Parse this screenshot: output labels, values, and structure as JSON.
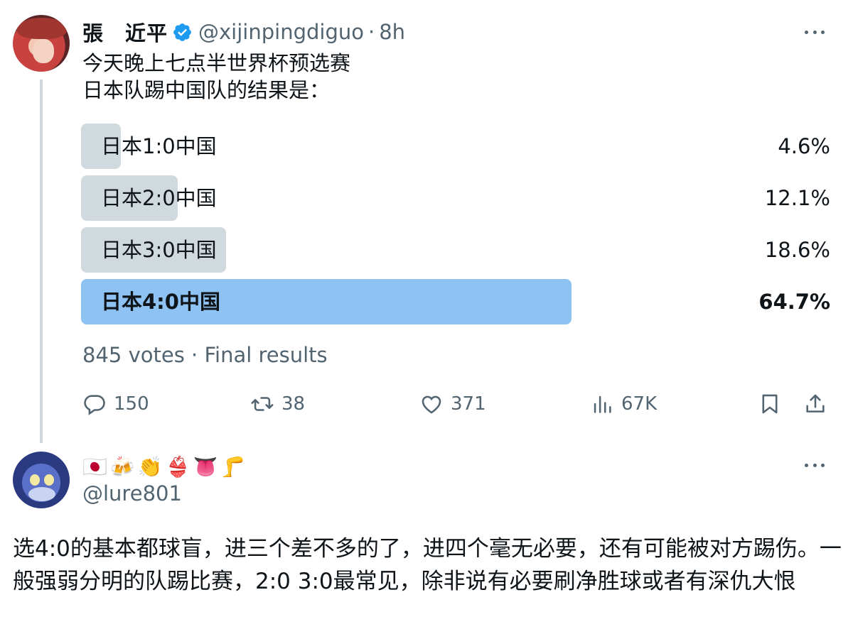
{
  "tweet": {
    "display_name": "張　近平",
    "handle": "@xijinpingdiguo",
    "separator": "·",
    "time": "8h",
    "text_line1": "今天晚上七点半世界杯预选赛",
    "text_line2": "日本队踢中国队的结果是：",
    "poll": {
      "options": [
        {
          "label": "日本1:0中国",
          "percent_text": "4.6%",
          "percent": 4.6,
          "winner": false
        },
        {
          "label": "日本2:0中国",
          "percent_text": "12.1%",
          "percent": 12.1,
          "winner": false
        },
        {
          "label": "日本3:0中国",
          "percent_text": "18.6%",
          "percent": 18.6,
          "winner": false
        },
        {
          "label": "日本4:0中国",
          "percent_text": "64.7%",
          "percent": 64.7,
          "winner": true
        }
      ],
      "meta": "845 votes · Final results"
    },
    "actions": {
      "replies": "150",
      "retweets": "38",
      "likes": "371",
      "views": "67K"
    },
    "colors": {
      "poll_bar": "#cfd9de",
      "poll_winner": "#8ec2f3",
      "verified": "#1d9bf0",
      "muted_text": "#536471"
    }
  },
  "reply": {
    "name_emojis": [
      "🇯🇵",
      "🍻",
      "👏",
      "👙",
      "👅",
      "🦵"
    ],
    "handle": "@lure801",
    "text": "选4:0的基本都球盲，进三个差不多的了，进四个毫无必要，还有可能被对方踢伤。一般强弱分明的队踢比赛，2:0 3:0最常见，除非说有必要刷净胜球或者有深仇大恨"
  }
}
